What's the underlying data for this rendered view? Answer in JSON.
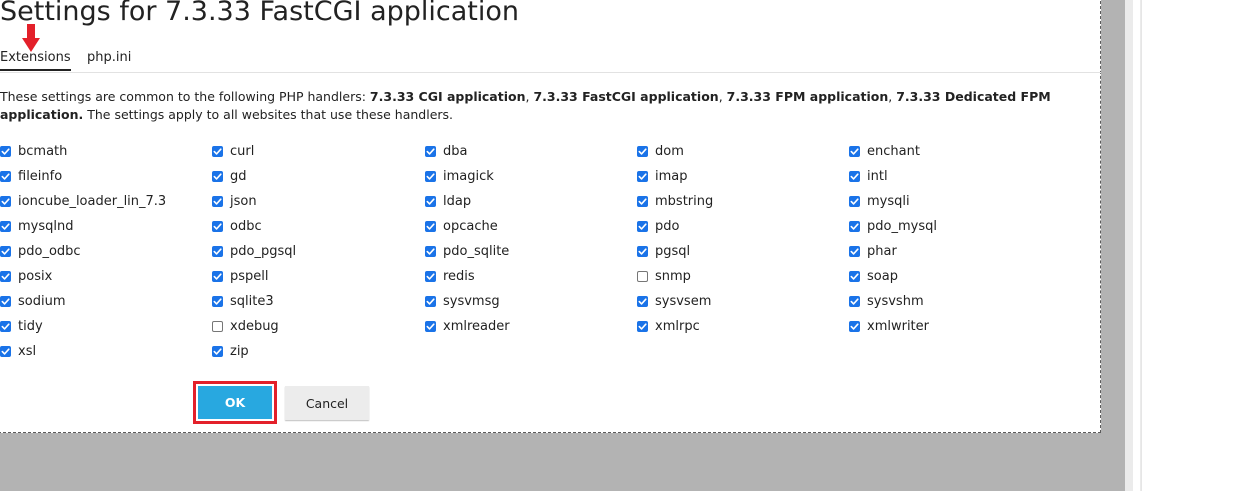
{
  "colors": {
    "accent": "#28a8e0",
    "checkbox": "#1a73e8",
    "highlight": "#e3202a",
    "overlay": "#b3b3b3"
  },
  "dialog": {
    "title": "Settings for 7.3.33 FastCGI application",
    "tabs": [
      {
        "label": "Extensions",
        "active": true
      },
      {
        "label": "php.ini",
        "active": false
      }
    ],
    "description": {
      "prefix": "These settings are common to the following PHP handlers: ",
      "handlers": [
        "7.3.33 CGI application",
        "7.3.33 FastCGI application",
        "7.3.33 FPM application",
        "7.3.33 Dedicated FPM application."
      ],
      "separator": ", ",
      "suffix": " The settings apply to all websites that use these handlers."
    },
    "extensions": [
      {
        "name": "bcmath",
        "checked": true
      },
      {
        "name": "curl",
        "checked": true
      },
      {
        "name": "dba",
        "checked": true
      },
      {
        "name": "dom",
        "checked": true
      },
      {
        "name": "enchant",
        "checked": true
      },
      {
        "name": "fileinfo",
        "checked": true
      },
      {
        "name": "gd",
        "checked": true
      },
      {
        "name": "imagick",
        "checked": true
      },
      {
        "name": "imap",
        "checked": true
      },
      {
        "name": "intl",
        "checked": true
      },
      {
        "name": "ioncube_loader_lin_7.3",
        "checked": true
      },
      {
        "name": "json",
        "checked": true
      },
      {
        "name": "ldap",
        "checked": true
      },
      {
        "name": "mbstring",
        "checked": true
      },
      {
        "name": "mysqli",
        "checked": true
      },
      {
        "name": "mysqlnd",
        "checked": true
      },
      {
        "name": "odbc",
        "checked": true
      },
      {
        "name": "opcache",
        "checked": true
      },
      {
        "name": "pdo",
        "checked": true
      },
      {
        "name": "pdo_mysql",
        "checked": true
      },
      {
        "name": "pdo_odbc",
        "checked": true
      },
      {
        "name": "pdo_pgsql",
        "checked": true
      },
      {
        "name": "pdo_sqlite",
        "checked": true
      },
      {
        "name": "pgsql",
        "checked": true
      },
      {
        "name": "phar",
        "checked": true
      },
      {
        "name": "posix",
        "checked": true
      },
      {
        "name": "pspell",
        "checked": true
      },
      {
        "name": "redis",
        "checked": true
      },
      {
        "name": "snmp",
        "checked": false
      },
      {
        "name": "soap",
        "checked": true
      },
      {
        "name": "sodium",
        "checked": true
      },
      {
        "name": "sqlite3",
        "checked": true
      },
      {
        "name": "sysvmsg",
        "checked": true
      },
      {
        "name": "sysvsem",
        "checked": true
      },
      {
        "name": "sysvshm",
        "checked": true
      },
      {
        "name": "tidy",
        "checked": true
      },
      {
        "name": "xdebug",
        "checked": false
      },
      {
        "name": "xmlreader",
        "checked": true
      },
      {
        "name": "xmlrpc",
        "checked": true
      },
      {
        "name": "xmlwriter",
        "checked": true
      },
      {
        "name": "xsl",
        "checked": true
      },
      {
        "name": "zip",
        "checked": true
      }
    ],
    "buttons": {
      "ok": "OK",
      "cancel": "Cancel"
    }
  },
  "annotations": {
    "arrow_icon": "red-down-arrow-icon",
    "ok_highlight": "red-rectangle"
  }
}
